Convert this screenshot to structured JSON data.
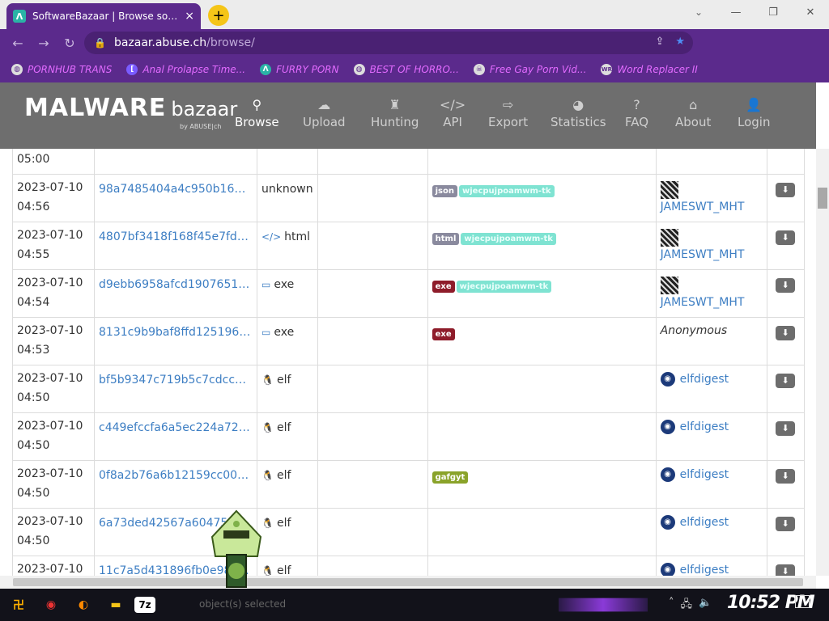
{
  "browser": {
    "tab_title": "SoftwareBazaar | Browse softw",
    "tab_close": "×",
    "new_tab": "+",
    "url_host": "bazaar.abuse.ch",
    "url_path": "/browse/",
    "bookmarks": [
      {
        "label": "PORNHUB TRANS",
        "icon": "globe"
      },
      {
        "label": "Anal Prolapse Time...",
        "icon": "bracket"
      },
      {
        "label": "FURRY PORN",
        "icon": "lambda"
      },
      {
        "label": "BEST OF HORRO...",
        "icon": "globe"
      },
      {
        "label": "Free Gay Porn Vid...",
        "icon": "skull"
      },
      {
        "label": "Word Replacer II",
        "icon": "WR"
      }
    ]
  },
  "site": {
    "logo_main": "MALWARE",
    "logo_sub": "bazaar",
    "logo_by": "by ABUSE|ch",
    "nav": [
      {
        "label": "Browse",
        "icon": "search"
      },
      {
        "label": "Upload",
        "icon": "cloud-upload"
      },
      {
        "label": "Hunting",
        "icon": "chess-rook"
      },
      {
        "label": "API",
        "icon": "code"
      },
      {
        "label": "Export",
        "icon": "file-export"
      },
      {
        "label": "Statistics",
        "icon": "pie-chart"
      },
      {
        "label": "FAQ",
        "icon": "question"
      },
      {
        "label": "About",
        "icon": "building"
      },
      {
        "label": "Login",
        "icon": "user"
      }
    ]
  },
  "rows": [
    {
      "date": "",
      "time": "05:00",
      "hash": "",
      "type": "",
      "tags": [],
      "reporter": "",
      "reporter_kind": "none"
    },
    {
      "date": "2023-07-10",
      "time": "04:56",
      "hash": "98a7485404a4c950b167e...",
      "type": "unknown",
      "type_icon": "",
      "tags": [
        "json",
        "wjecpujpoamwm-tk"
      ],
      "reporter": "JAMESWT_MHT",
      "reporter_kind": "avatar"
    },
    {
      "date": "2023-07-10",
      "time": "04:55",
      "hash": "4807bf3418f168f45e7fdf3...",
      "type": "html",
      "type_icon": "</>",
      "tags": [
        "html",
        "wjecpujpoamwm-tk"
      ],
      "reporter": "JAMESWT_MHT",
      "reporter_kind": "avatar"
    },
    {
      "date": "2023-07-10",
      "time": "04:54",
      "hash": "d9ebb6958afcd190765148...",
      "type": "exe",
      "type_icon": "▭",
      "tags": [
        "exe",
        "wjecpujpoamwm-tk"
      ],
      "reporter": "JAMESWT_MHT",
      "reporter_kind": "avatar"
    },
    {
      "date": "2023-07-10",
      "time": "04:53",
      "hash": "8131c9b9baf8ffd125196f01...",
      "type": "exe",
      "type_icon": "▭",
      "tags": [
        "exe"
      ],
      "reporter": "Anonymous",
      "reporter_kind": "anon"
    },
    {
      "date": "2023-07-10",
      "time": "04:50",
      "hash": "bf5b9347c719b5c7cdcc8f...",
      "type": "elf",
      "type_icon": "🐧",
      "tags": [],
      "reporter": "elfdigest",
      "reporter_kind": "eye"
    },
    {
      "date": "2023-07-10",
      "time": "04:50",
      "hash": "c449efccfa6a5ec224a728...",
      "type": "elf",
      "type_icon": "🐧",
      "tags": [],
      "reporter": "elfdigest",
      "reporter_kind": "eye"
    },
    {
      "date": "2023-07-10",
      "time": "04:50",
      "hash": "0f8a2b76a6b12159cc006a...",
      "type": "elf",
      "type_icon": "🐧",
      "tags": [
        "gafgyt"
      ],
      "reporter": "elfdigest",
      "reporter_kind": "eye"
    },
    {
      "date": "2023-07-10",
      "time": "04:50",
      "hash": "6a73ded42567a60475...",
      "type": "elf",
      "type_icon": "🐧",
      "tags": [],
      "reporter": "elfdigest",
      "reporter_kind": "eye"
    },
    {
      "date": "2023-07-10",
      "time": "",
      "hash": "11c7a5d431896fb0e98d...",
      "type": "elf",
      "type_icon": "🐧",
      "tags": [],
      "reporter": "elfdigest",
      "reporter_kind": "eye"
    }
  ],
  "taskbar": {
    "status_text": "object(s) selected",
    "clock": "10:52 PM",
    "app_7z": "7z"
  },
  "colors": {
    "browser_accent": "#5b2a8c",
    "header_bg": "#6e6e6e",
    "link": "#3d7ec3",
    "tag_exe": "#8e1c2a",
    "tag_gafgyt": "#8aa32a",
    "tag_family": "#7fe3d2"
  }
}
